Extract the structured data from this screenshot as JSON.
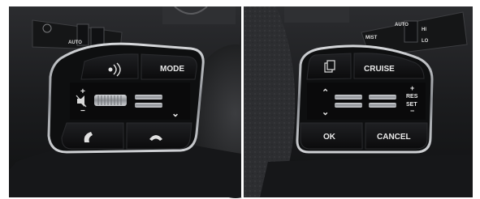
{
  "left_panel": {
    "stalk_labels": {
      "auto": "AUTO"
    },
    "buttons": {
      "mode": "MODE",
      "volume_plus": "+",
      "volume_minus": "−",
      "down_arrow": "⌄"
    }
  },
  "right_panel": {
    "stalk_labels": {
      "mist": "MIST",
      "auto": "AUTO",
      "hi": "HI",
      "lo": "LO"
    },
    "buttons": {
      "cruise": "CRUISE",
      "res": "RES",
      "set": "SET",
      "plus": "+",
      "minus": "−",
      "ok": "OK",
      "cancel": "CANCEL",
      "up_arrow": "⌃",
      "down_arrow": "⌄"
    }
  },
  "colors": {
    "dashboard": "#1a1b1d",
    "panel": "#121315",
    "chrome": "#b9bcc0",
    "wheel": "#2a2b2d",
    "text": "#e9e9e9"
  }
}
